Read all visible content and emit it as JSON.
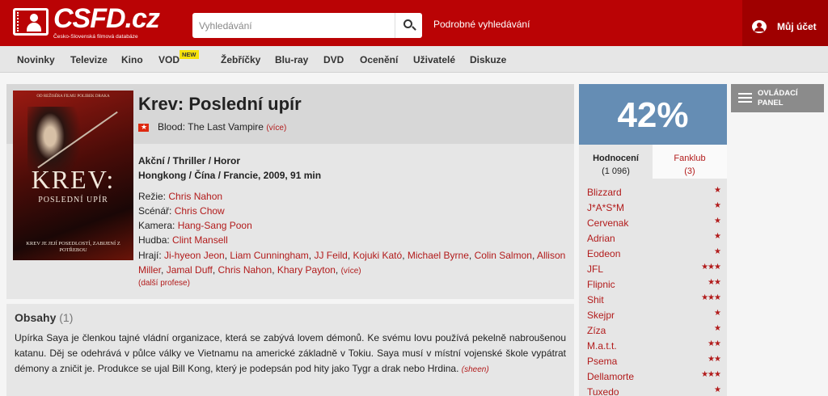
{
  "header": {
    "logo_text": "CSFD.cz",
    "logo_subtitle": "Česko-Slovenská filmová databáze",
    "search_placeholder": "Vyhledávání",
    "advanced_search": "Podrobné vyhledávání",
    "account": "Můj účet"
  },
  "nav": {
    "items": [
      "Novinky",
      "Televize",
      "Kino",
      "VOD",
      "Žebříčky",
      "Blu-ray",
      "DVD",
      "Ocenění",
      "Uživatelé",
      "Diskuze"
    ],
    "vod_badge": "NEW"
  },
  "film": {
    "poster": {
      "top_text": "OD REŽISÉRA FILMU POLIBEK DRAKA",
      "title": "KREV:",
      "subtitle": "POSLEDNÍ UPÍR",
      "tagline": "KREV JE JEJÍ POSEDLOSTÍ, ZABIJENÍ Z POTŘEBOU"
    },
    "title": "Krev: Poslední upír",
    "original_title": "Blood: The Last Vampire",
    "original_more": "(více)",
    "genres": "Akční / Thriller / Horor",
    "origin": "Hongkong / Čína / Francie, 2009, 91 min",
    "creators": [
      {
        "role": "Režie:",
        "name": "Chris Nahon"
      },
      {
        "role": "Scénář:",
        "name": "Chris Chow"
      },
      {
        "role": "Kamera:",
        "name": "Hang-Sang Poon"
      },
      {
        "role": "Hudba:",
        "name": "Clint Mansell"
      }
    ],
    "cast_label": "Hrají:",
    "cast": [
      "Ji-hyeon Jeon",
      "Liam Cunningham",
      "JJ Feild",
      "Kojuki Kató",
      "Michael Byrne",
      "Colin Salmon",
      "Allison Miller",
      "Jamal Duff",
      "Chris Nahon",
      "Khary Payton"
    ],
    "cast_more": "(více)",
    "more_professions": "(další profese)"
  },
  "plot": {
    "heading": "Obsahy",
    "count": "(1)",
    "text": "Upírka Saya je členkou tajné vládní organizace, která se zabývá lovem démonů. Ke svému lovu používá pekelně nabroušenou katanu. Děj se odehrává v půlce války ve Vietnamu na americké základně v Tokiu. Saya musí v místní vojenské škole vypátrat démony a zničit je. Produkce se ujal Bill Kong, který je podepsán pod hity jako Tygr a drak nebo Hrdina.",
    "author": "(sheen)"
  },
  "rating": {
    "value": "42%",
    "accent_color": "#658db4",
    "tabs": [
      {
        "label": "Hodnocení",
        "count": "(1 096)"
      },
      {
        "label": "Fanklub",
        "count": "(3)"
      }
    ],
    "users": [
      {
        "name": "Blizzard",
        "stars": "★"
      },
      {
        "name": "J*A*S*M",
        "stars": "★"
      },
      {
        "name": "Cervenak",
        "stars": "★"
      },
      {
        "name": "Adrian",
        "stars": "★"
      },
      {
        "name": "Eodeon",
        "stars": "★"
      },
      {
        "name": "JFL",
        "stars": "★★★"
      },
      {
        "name": "Flipnic",
        "stars": "★★"
      },
      {
        "name": "Shit",
        "stars": "★★★"
      },
      {
        "name": "Skejpr",
        "stars": "★"
      },
      {
        "name": "Zíza",
        "stars": "★"
      },
      {
        "name": "M.a.t.t.",
        "stars": "★★"
      },
      {
        "name": "Psema",
        "stars": "★★"
      },
      {
        "name": "Dellamorte",
        "stars": "★★★"
      },
      {
        "name": "Tuxedo",
        "stars": "★"
      }
    ]
  },
  "control_panel": {
    "label": "OVLÁDACÍ PANEL"
  }
}
